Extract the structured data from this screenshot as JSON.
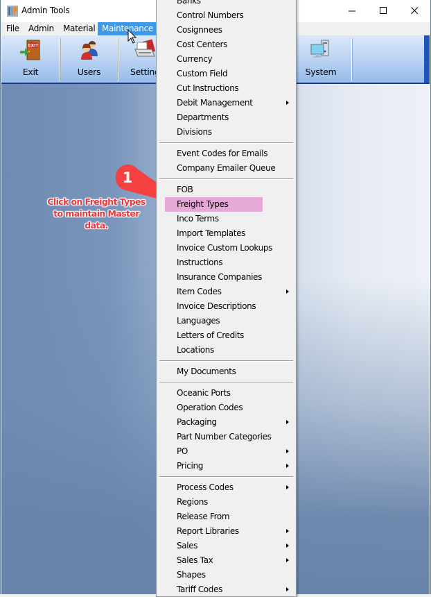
{
  "window": {
    "title": "Admin Tools",
    "icon": "admin-tools-icon",
    "controls": {
      "minimize": "—",
      "maximize": "☐",
      "close": "✕"
    }
  },
  "menubar": {
    "items": [
      {
        "label": "File"
      },
      {
        "label": "Admin"
      },
      {
        "label": "Material"
      },
      {
        "label": "Maintenance",
        "active": true
      }
    ]
  },
  "toolbar": {
    "buttons": [
      {
        "label": "Exit",
        "icon": "exit-door-icon"
      },
      {
        "label": "Users",
        "icon": "users-icon"
      },
      {
        "label": "Settings",
        "icon": "settings-printer-icon"
      },
      {
        "label": "System",
        "icon": "computer-system-icon"
      }
    ]
  },
  "maintenance_menu": {
    "items": [
      {
        "label": "Banks"
      },
      {
        "label": "Control Numbers"
      },
      {
        "label": "Cosignnees"
      },
      {
        "label": "Cost Centers"
      },
      {
        "label": "Currency"
      },
      {
        "label": "Custom Field"
      },
      {
        "label": "Cut Instructions"
      },
      {
        "label": "Debit Management",
        "submenu": true
      },
      {
        "label": "Departments"
      },
      {
        "label": "Divisions"
      },
      {
        "separator": true
      },
      {
        "label": "Event Codes for Emails"
      },
      {
        "label": "Company Emailer Queue"
      },
      {
        "separator": true
      },
      {
        "label": "FOB"
      },
      {
        "label": "Freight Types",
        "highlighted": true
      },
      {
        "label": "Inco Terms"
      },
      {
        "label": "Import Templates"
      },
      {
        "label": "Invoice Custom Lookups"
      },
      {
        "label": "Instructions"
      },
      {
        "label": "Insurance Companies"
      },
      {
        "label": "Item Codes",
        "submenu": true
      },
      {
        "label": "Invoice Descriptions"
      },
      {
        "label": "Languages"
      },
      {
        "label": "Letters of Credits"
      },
      {
        "label": "Locations"
      },
      {
        "separator": true
      },
      {
        "label": "My Documents"
      },
      {
        "separator": true
      },
      {
        "label": "Oceanic Ports"
      },
      {
        "label": "Operation Codes"
      },
      {
        "label": "Packaging",
        "submenu": true
      },
      {
        "label": "Part Number Categories"
      },
      {
        "label": "PO",
        "submenu": true
      },
      {
        "label": "Pricing",
        "submenu": true
      },
      {
        "separator": true
      },
      {
        "label": "Process Codes",
        "submenu": true
      },
      {
        "label": "Regions"
      },
      {
        "label": "Release From"
      },
      {
        "label": "Report Libraries",
        "submenu": true
      },
      {
        "label": "Sales",
        "submenu": true
      },
      {
        "label": "Sales Tax",
        "submenu": true
      },
      {
        "label": "Shapes"
      },
      {
        "label": "Tariff Codes",
        "submenu": true
      }
    ]
  },
  "annotation": {
    "step_number": "1",
    "text": "Click on Freight Types to maintain Master data.",
    "color": "#e8373b",
    "highlight_color": "#e6a8d6"
  }
}
